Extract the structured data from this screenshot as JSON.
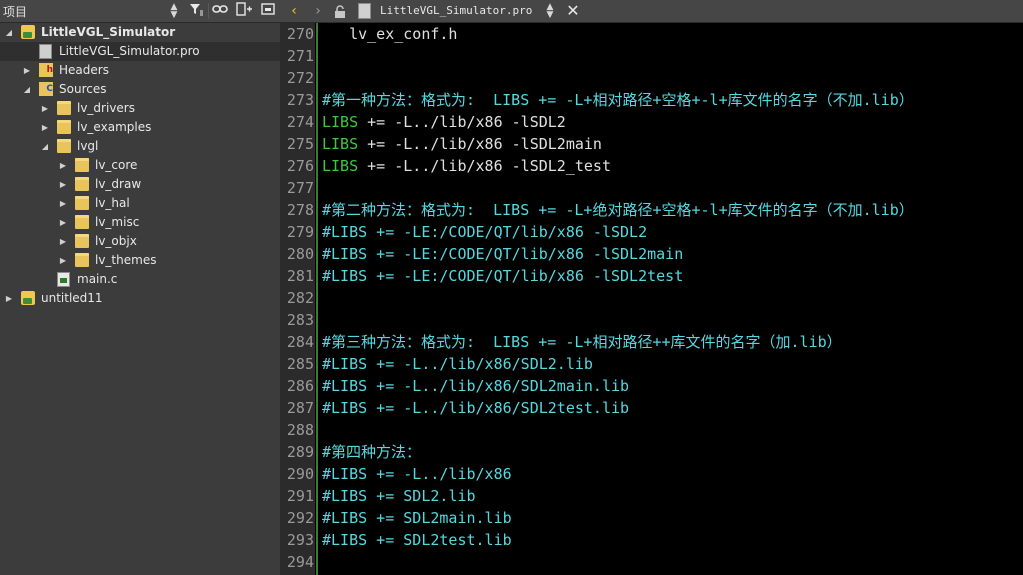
{
  "project_pane": {
    "title": "项目",
    "tree": [
      {
        "label": "LittleVGL_Simulator",
        "icon": "project-icon",
        "arrow": "expanded",
        "bold": true,
        "level": 0
      },
      {
        "label": "LittleVGL_Simulator.pro",
        "icon": "pro-file-icon",
        "arrow": "none",
        "bold": false,
        "level": 1,
        "selected": true
      },
      {
        "label": "Headers",
        "icon": "headers-folder-icon",
        "arrow": "collapsed",
        "level": 1
      },
      {
        "label": "Sources",
        "icon": "sources-folder-icon",
        "arrow": "expanded",
        "level": 1
      },
      {
        "label": "lv_drivers",
        "icon": "folder-icon",
        "arrow": "collapsed",
        "level": 2
      },
      {
        "label": "lv_examples",
        "icon": "folder-icon",
        "arrow": "collapsed",
        "level": 2
      },
      {
        "label": "lvgl",
        "icon": "folder-icon",
        "arrow": "expanded",
        "level": 2
      },
      {
        "label": "lv_core",
        "icon": "folder-icon",
        "arrow": "collapsed",
        "level": 3
      },
      {
        "label": "lv_draw",
        "icon": "folder-icon",
        "arrow": "collapsed",
        "level": 3
      },
      {
        "label": "lv_hal",
        "icon": "folder-icon",
        "arrow": "collapsed",
        "level": 3
      },
      {
        "label": "lv_misc",
        "icon": "folder-icon",
        "arrow": "collapsed",
        "level": 3
      },
      {
        "label": "lv_objx",
        "icon": "folder-icon",
        "arrow": "collapsed",
        "level": 3
      },
      {
        "label": "lv_themes",
        "icon": "folder-icon",
        "arrow": "collapsed",
        "level": 3
      },
      {
        "label": "main.c",
        "icon": "c-file-icon",
        "arrow": "none",
        "level": 2
      },
      {
        "label": "untitled11",
        "icon": "project-icon",
        "arrow": "collapsed",
        "level": 0
      }
    ]
  },
  "editor": {
    "file_name": "LittleVGL_Simulator.pro",
    "lines": [
      {
        "num": "270",
        "text": "   lv_ex_conf.h",
        "color": "#e0e0e0"
      },
      {
        "num": "271",
        "text": "",
        "color": "#e0e0e0"
      },
      {
        "num": "272",
        "text": "",
        "color": "#e0e0e0"
      },
      {
        "num": "273",
        "text": "#第一种方法：格式为:  LIBS += -L+相对路径+空格+-l+库文件的名字（不加.lib）",
        "color": "#56d8e0"
      },
      {
        "num": "274",
        "text": "LIBS += -L../lib/x86 -lSDL2",
        "color": "#e0e0e0",
        "kw": "LIBS"
      },
      {
        "num": "275",
        "text": "LIBS += -L../lib/x86 -lSDL2main",
        "color": "#e0e0e0",
        "kw": "LIBS"
      },
      {
        "num": "276",
        "text": "LIBS += -L../lib/x86 -lSDL2_test",
        "color": "#e0e0e0",
        "kw": "LIBS"
      },
      {
        "num": "277",
        "text": "",
        "color": "#e0e0e0"
      },
      {
        "num": "278",
        "text": "#第二种方法：格式为:  LIBS += -L+绝对路径+空格+-l+库文件的名字（不加.lib）",
        "color": "#56d8e0"
      },
      {
        "num": "279",
        "text": "#LIBS += -LE:/CODE/QT/lib/x86 -lSDL2",
        "color": "#56d8e0"
      },
      {
        "num": "280",
        "text": "#LIBS += -LE:/CODE/QT/lib/x86 -lSDL2main",
        "color": "#56d8e0"
      },
      {
        "num": "281",
        "text": "#LIBS += -LE:/CODE/QT/lib/x86 -lSDL2test",
        "color": "#56d8e0"
      },
      {
        "num": "282",
        "text": "",
        "color": "#e0e0e0"
      },
      {
        "num": "283",
        "text": "",
        "color": "#e0e0e0"
      },
      {
        "num": "284",
        "text": "#第三种方法：格式为:  LIBS += -L+相对路径++库文件的名字（加.lib）",
        "color": "#56d8e0"
      },
      {
        "num": "285",
        "text": "#LIBS += -L../lib/x86/SDL2.lib",
        "color": "#56d8e0"
      },
      {
        "num": "286",
        "text": "#LIBS += -L../lib/x86/SDL2main.lib",
        "color": "#56d8e0"
      },
      {
        "num": "287",
        "text": "#LIBS += -L../lib/x86/SDL2test.lib",
        "color": "#56d8e0"
      },
      {
        "num": "288",
        "text": "",
        "color": "#e0e0e0"
      },
      {
        "num": "289",
        "text": "#第四种方法：",
        "color": "#56d8e0"
      },
      {
        "num": "290",
        "text": "#LIBS += -L../lib/x86",
        "color": "#56d8e0"
      },
      {
        "num": "291",
        "text": "#LIBS += SDL2.lib",
        "color": "#56d8e0"
      },
      {
        "num": "292",
        "text": "#LIBS += SDL2main.lib",
        "color": "#56d8e0"
      },
      {
        "num": "293",
        "text": "#LIBS += SDL2test.lib",
        "color": "#56d8e0"
      },
      {
        "num": "294",
        "text": "",
        "color": "#e0e0e0"
      }
    ]
  },
  "colors": {
    "comment": "#56d8e0",
    "keyword": "#3ec83e",
    "default": "#e0e0e0"
  }
}
